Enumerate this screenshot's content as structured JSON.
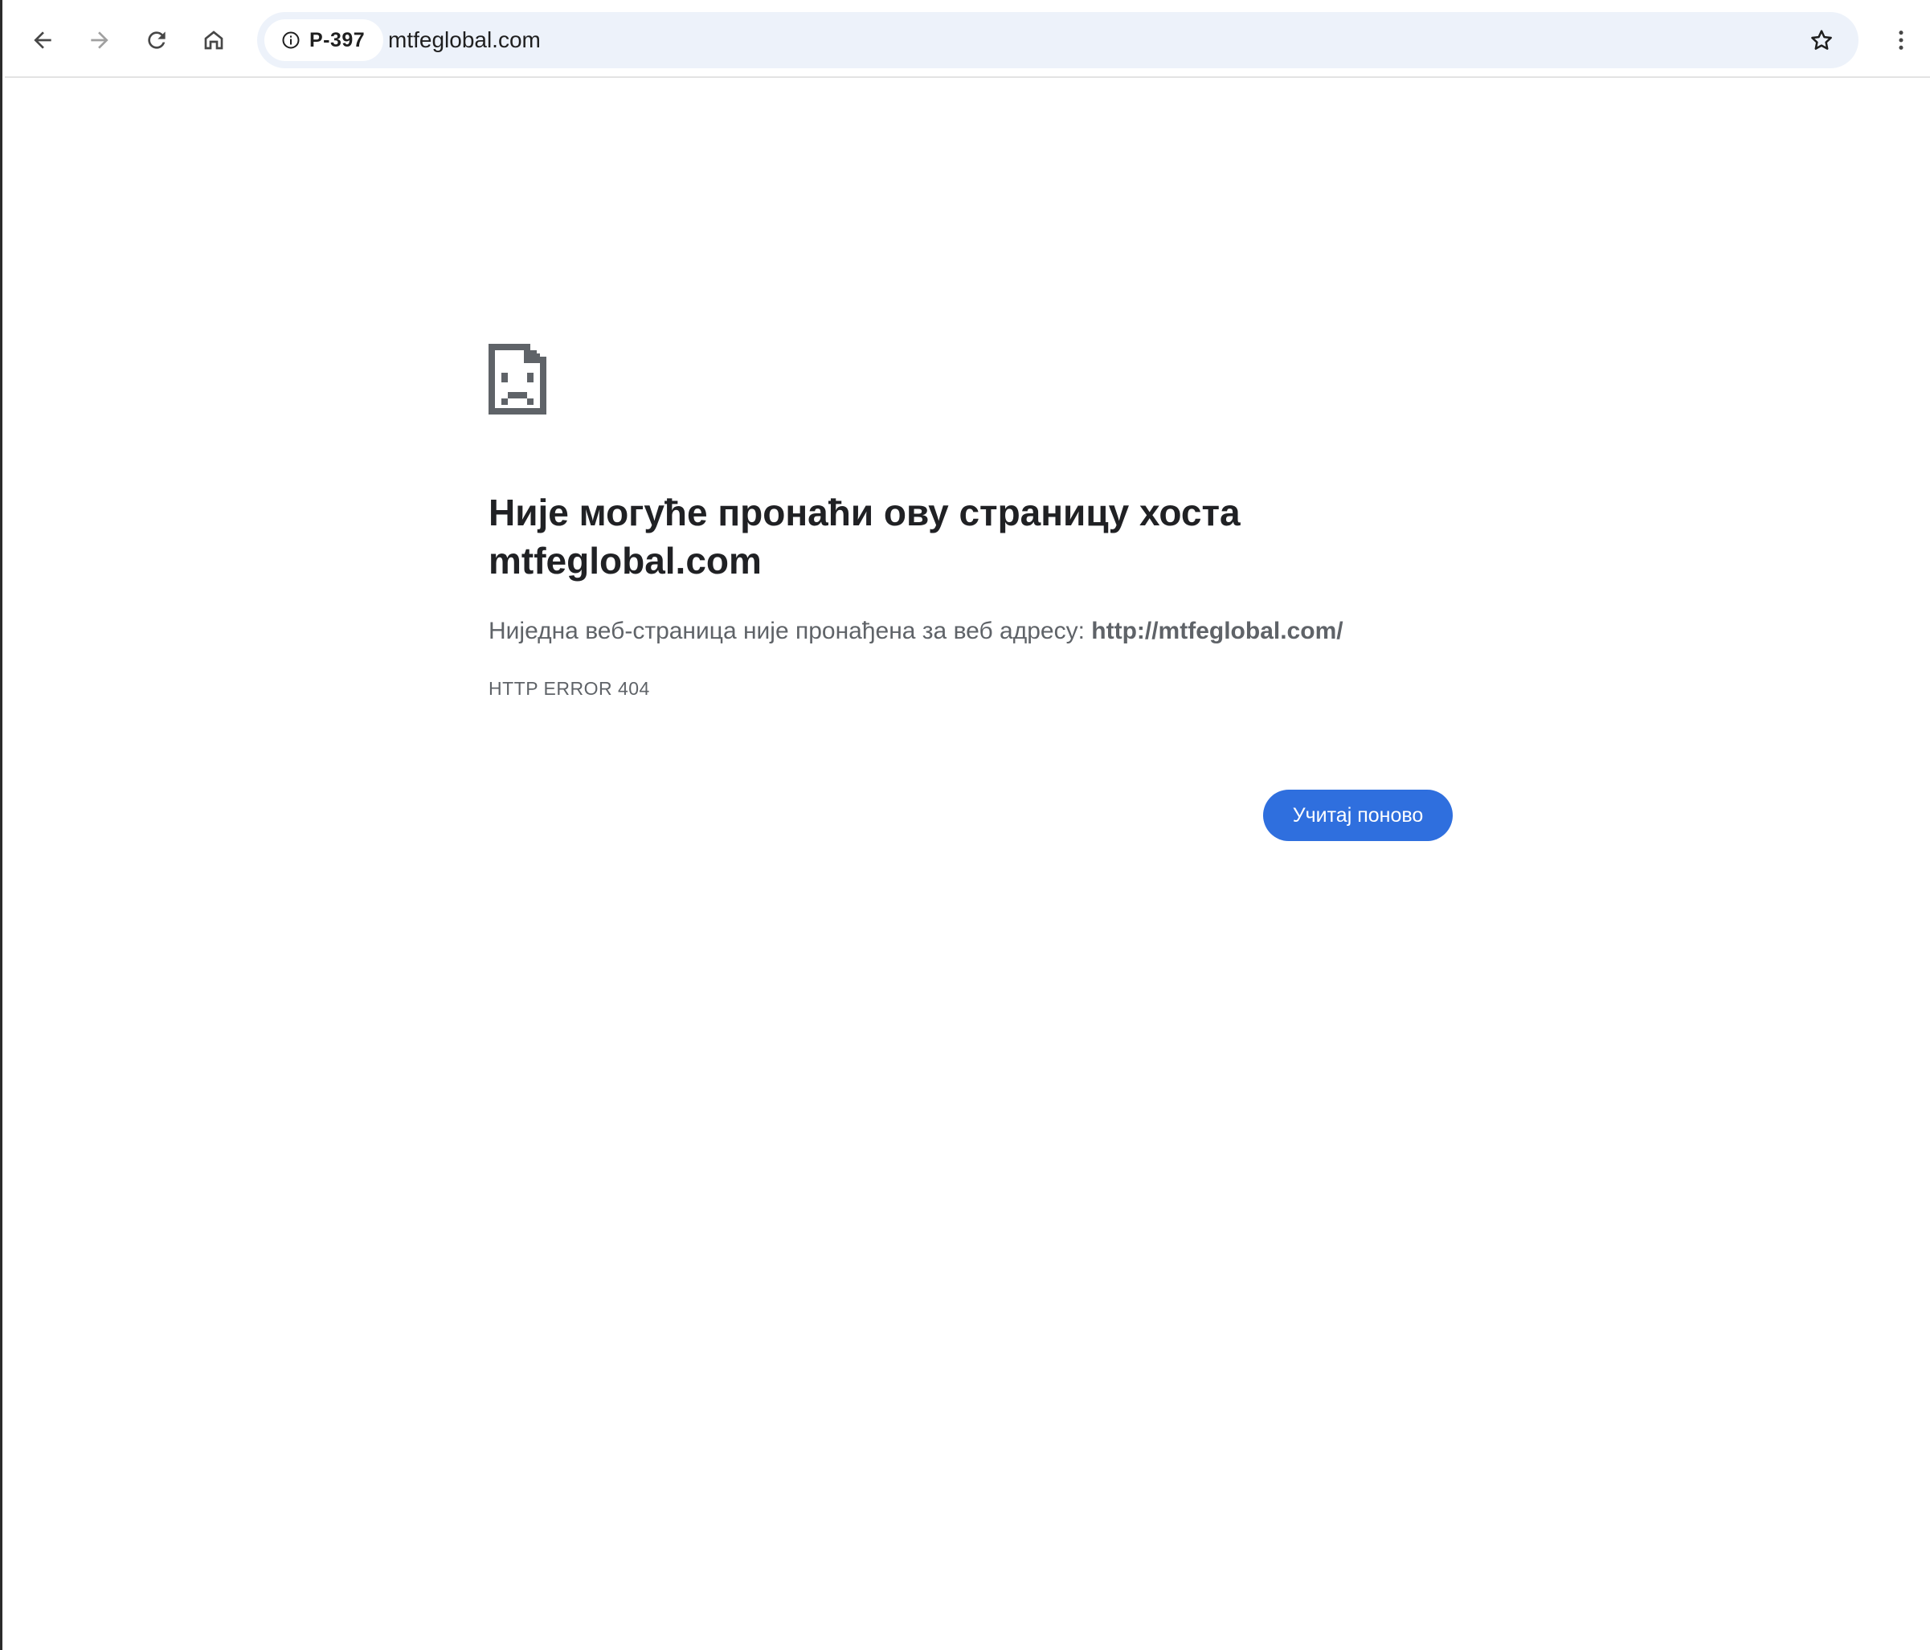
{
  "toolbar": {
    "back_icon": "arrow-left-icon",
    "forward_icon": "arrow-right-icon",
    "reload_icon": "reload-icon",
    "home_icon": "home-icon",
    "omnibox": {
      "chip_label": "P-397",
      "chip_icon": "info-icon",
      "url": "mtfeglobal.com"
    },
    "bookmark_icon": "star-icon",
    "menu_icon": "kebab-menu-icon"
  },
  "error_page": {
    "icon": "sad-document-icon",
    "title_line1": "Није могуће пронаћи ову страницу хоста",
    "title_line2": "mtfeglobal.com",
    "description_prefix": "Ниједна веб-страница није пронађена за веб адресу: ",
    "description_url": "http://mtfeglobal.com/",
    "error_code": "HTTP ERROR 404",
    "reload_label": "Учитај поново"
  },
  "colors": {
    "accent": "#2f6fde",
    "omnibox_bg": "#edf2fa",
    "title_text": "#202124",
    "secondary_text": "#5f6368"
  }
}
